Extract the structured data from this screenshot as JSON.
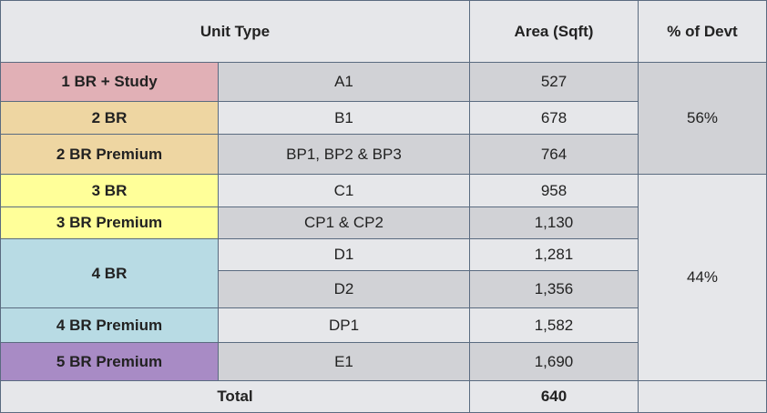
{
  "colors": {
    "header_bg": "#e6e7ea",
    "row_light": "#e6e7ea",
    "row_dark": "#d1d2d6",
    "border": "#5a6b80",
    "one_br_study": "#e1b0b6",
    "two_br": "#eed6a2",
    "three_br": "#ffff99",
    "four_br": "#b8dbe4",
    "five_br": "#a88bc5"
  },
  "header": {
    "unit_type": "Unit Type",
    "area": "Area (Sqft)",
    "pct_devt": "% of Devt"
  },
  "groups": [
    {
      "pct": "56%"
    },
    {
      "pct": "44%"
    }
  ],
  "rows": [
    {
      "category": "1 BR + Study",
      "type": "A1",
      "area": "527"
    },
    {
      "category": "2 BR",
      "type": "B1",
      "area": "678"
    },
    {
      "category": "2 BR Premium",
      "type": "BP1, BP2 & BP3",
      "area": "764"
    },
    {
      "category": "3 BR",
      "type": "C1",
      "area": "958"
    },
    {
      "category": "3 BR Premium",
      "type": "CP1 & CP2",
      "area": "1,130"
    },
    {
      "category": "4 BR",
      "type": "D1",
      "area": "1,281"
    },
    {
      "type": "D2",
      "area": "1,356"
    },
    {
      "category": "4 BR Premium",
      "type": "DP1",
      "area": "1,582"
    },
    {
      "category": "5 BR Premium",
      "type": "E1",
      "area": "1,690"
    }
  ],
  "total": {
    "label": "Total",
    "value": "640"
  }
}
